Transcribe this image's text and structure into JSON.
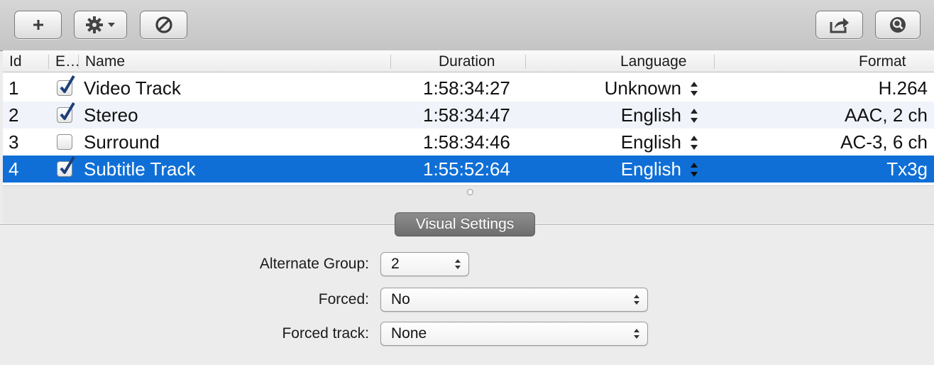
{
  "toolbar": {
    "add_icon": "plus-icon",
    "action_icon": "gear-dropdown-icon",
    "remove_icon": "prohibited-icon",
    "share_icon": "share-icon",
    "search_icon": "search-icon"
  },
  "table": {
    "columns": [
      "Id",
      "E…",
      "Name",
      "Duration",
      "Language",
      "Format"
    ],
    "rows": [
      {
        "id": "1",
        "enabled": true,
        "name": "Video Track",
        "duration": "1:58:34:27",
        "language": "Unknown",
        "format": "H.264"
      },
      {
        "id": "2",
        "enabled": true,
        "name": "Stereo",
        "duration": "1:58:34:47",
        "language": "English",
        "format": "AAC, 2 ch"
      },
      {
        "id": "3",
        "enabled": false,
        "name": "Surround",
        "duration": "1:58:34:46",
        "language": "English",
        "format": "AC-3, 6 ch"
      },
      {
        "id": "4",
        "enabled": true,
        "name": "Subtitle Track",
        "duration": "1:55:52:64",
        "language": "English",
        "format": "Tx3g"
      }
    ],
    "selected_row": 4,
    "selection_color": "#0f6fd6"
  },
  "settings": {
    "tab_label": "Visual Settings",
    "alternate_group_label": "Alternate Group:",
    "alternate_group_value": "2",
    "forced_label": "Forced:",
    "forced_value": "No",
    "forced_track_label": "Forced track:",
    "forced_track_value": "None"
  }
}
